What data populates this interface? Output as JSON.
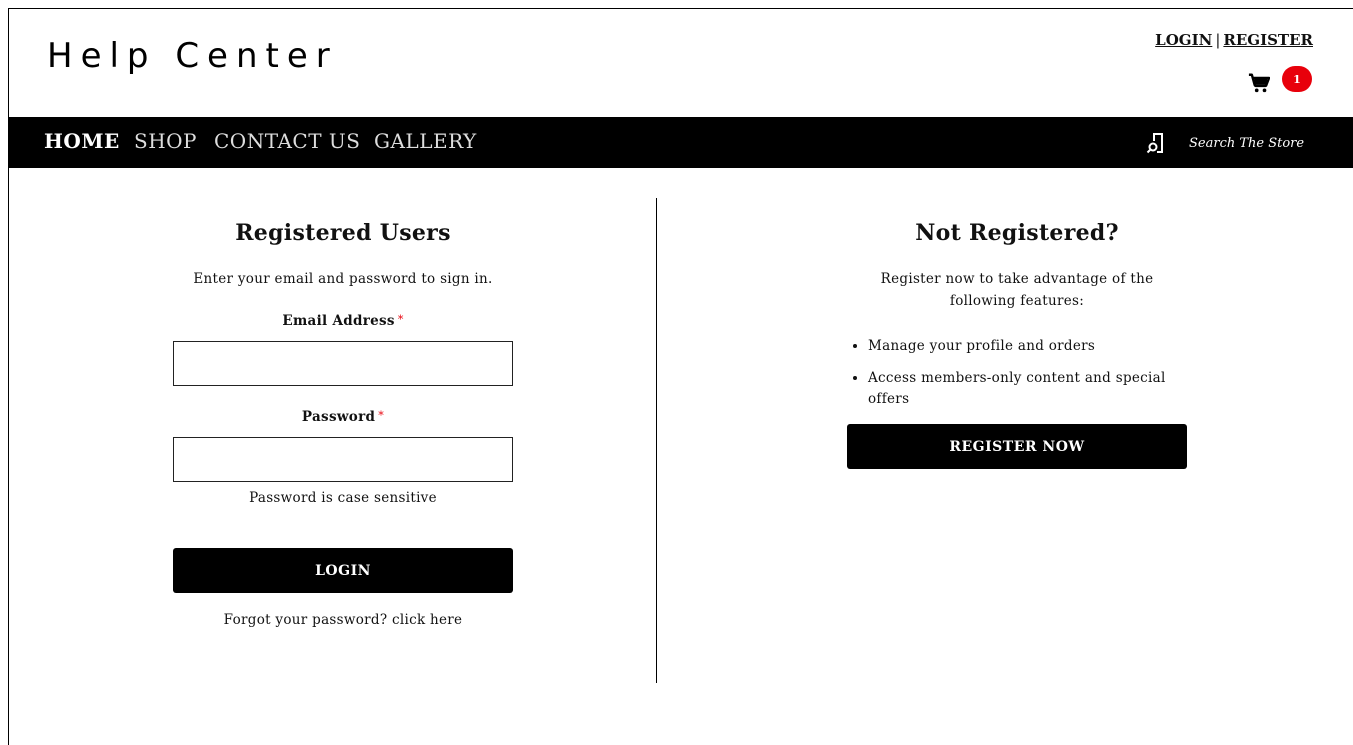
{
  "header": {
    "brand": "Help Center",
    "auth_login": "LOGIN",
    "auth_separator": "|",
    "auth_register": "REGISTER",
    "cart_count": "1",
    "badge_color": "#e8000b"
  },
  "nav": {
    "items": [
      {
        "label": "HOME",
        "active": true
      },
      {
        "label": "SHOP",
        "active": false
      },
      {
        "label": "CONTACT US",
        "active": false
      },
      {
        "label": "GALLERY",
        "active": false
      }
    ],
    "search_placeholder": "Search The Store",
    "search_icon": "search-icon"
  },
  "registered": {
    "title": "Registered Users",
    "intro": "Enter your email and password to sign in.",
    "email_label": "Email Address",
    "email_value": "",
    "password_label": "Password",
    "password_value": "",
    "required_mark": "*",
    "password_hint": "Password is case sensitive",
    "login_button": "LOGIN",
    "forgot": "Forgot your password? click here"
  },
  "not_registered": {
    "title": "Not Registered?",
    "intro": "Register now to take advantage of the following features:",
    "features": [
      "Manage your profile and orders",
      "Access members-only content and special offers"
    ],
    "register_button": "REGISTER NOW"
  }
}
